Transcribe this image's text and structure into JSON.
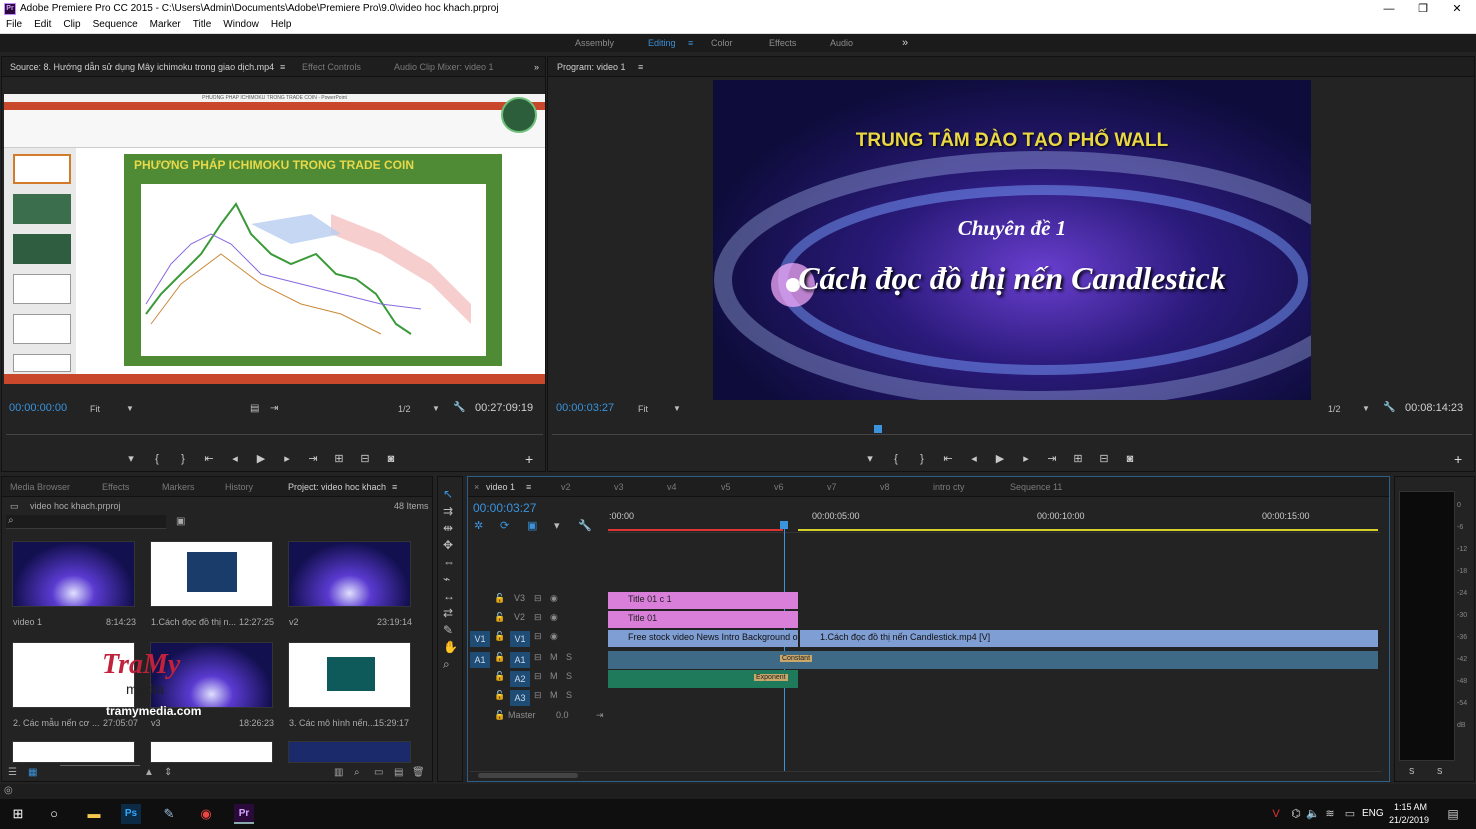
{
  "window": {
    "title": "Adobe Premiere Pro CC 2015 - C:\\Users\\Admin\\Documents\\Adobe\\Premiere Pro\\9.0\\video hoc khach.prproj",
    "minimize": "—",
    "maximize": "❐",
    "close": "✕"
  },
  "menu": [
    "File",
    "Edit",
    "Clip",
    "Sequence",
    "Marker",
    "Title",
    "Window",
    "Help"
  ],
  "workspaces": {
    "items": [
      "Assembly",
      "Editing",
      "Color",
      "Effects",
      "Audio"
    ],
    "active": "Editing",
    "more": "»"
  },
  "source": {
    "tab": "Source: 8. Hướng dẫn sử dụng Mây ichimoku trong giao dịch.mp4",
    "tab2": "Effect Controls",
    "tab3": "Audio Clip Mixer: video 1",
    "timecode": "00:00:00:00",
    "fit": "Fit",
    "res": "1/2",
    "duration": "00:27:09:19",
    "slide_title": "PHƯƠNG PHÁP ICHIMOKU TRONG TRADE COIN",
    "ppt_title": "PHUONG PHAP ICHIMOKU TRONG TRADE COIN - PowerPoint"
  },
  "program": {
    "tab": "Program: video 1",
    "timecode": "00:00:03:27",
    "fit": "Fit",
    "res": "1/2",
    "duration": "00:08:14:23",
    "line1": "TRUNG TÂM ĐÀO TẠO PHỐ WALL",
    "line2": "Chuyên đề 1",
    "line3": "Cách đọc đồ thị nến Candlestick"
  },
  "project": {
    "tabs": [
      "Media Browser",
      "Effects",
      "Markers",
      "History",
      "Project: video hoc khach"
    ],
    "file": "video hoc khach.prproj",
    "count": "48 Items",
    "items": [
      {
        "name": "video 1",
        "dur": "8:14:23"
      },
      {
        "name": "1.Cách đọc đồ thị n...",
        "dur": "12:27:25"
      },
      {
        "name": "v2",
        "dur": "23:19:14"
      },
      {
        "name": "2. Các mẫu nến cơ ...",
        "dur": "27:05:07"
      },
      {
        "name": "v3",
        "dur": "18:26:23"
      },
      {
        "name": "3. Các mô hình nến...",
        "dur": "15:29:17"
      }
    ],
    "watermark1": "TraMy",
    "watermark2": "media",
    "watermark3": "tramymedia.com"
  },
  "timeline": {
    "tabs": [
      "video 1",
      "v2",
      "v3",
      "v4",
      "v5",
      "v6",
      "v7",
      "v8",
      "intro cty",
      "Sequence 11"
    ],
    "timecode": "00:00:03:27",
    "ruler": [
      ":00:00",
      "00:00:05:00",
      "00:00:10:00",
      "00:00:15:00"
    ],
    "tracks": [
      "V3",
      "V2",
      "V1",
      "A1",
      "A2",
      "A3"
    ],
    "master": "Master",
    "master_val": "0.0",
    "src_v": "V1",
    "src_a": "A1",
    "m": "M",
    "s": "S",
    "clips": {
      "title1": "Title 01 c 1",
      "title2": "Title 01",
      "v1a": "Free stock video News Intro Background o",
      "v1b": "1.Cách đọc đồ thị nến Candlestick.mp4 [V]",
      "a1": "Constant",
      "a2": "Exponent"
    }
  },
  "meter": {
    "labels": [
      "0",
      "-6",
      "-12",
      "-18",
      "-24",
      "-30",
      "-36",
      "-42",
      "-48",
      "-54",
      "dB"
    ],
    "l": "S",
    "r": "S"
  },
  "taskbar": {
    "lang": "ENG",
    "time": "1:15 AM",
    "date": "21/2/2019"
  }
}
